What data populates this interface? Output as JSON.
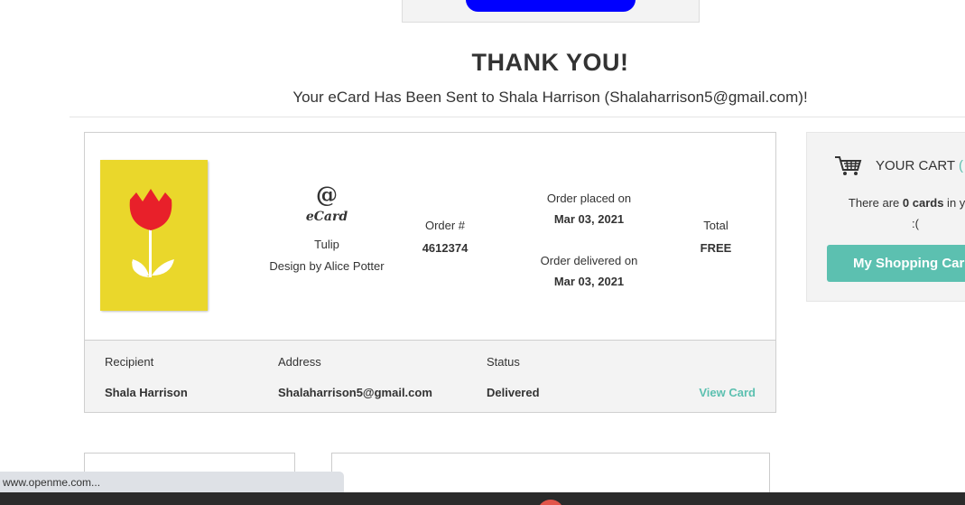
{
  "heading": {
    "title": "THANK YOU!",
    "subtitle": "Your eCard Has Been Sent to Shala Harrison (Shalaharrison5@gmail.com)!"
  },
  "order": {
    "card_icon": "at-sign-icon",
    "card_type": "eCard",
    "card_name": "Tulip",
    "card_designer": "Design by Alice Potter",
    "order_number_label": "Order #",
    "order_number": "4612374",
    "placed_label": "Order placed on",
    "placed_date": "Mar 03, 2021",
    "delivered_label": "Order delivered on",
    "delivered_date": "Mar 03, 2021",
    "total_label": "Total",
    "total_value": "FREE"
  },
  "details": {
    "recipient_label": "Recipient",
    "recipient": "Shala Harrison",
    "address_label": "Address",
    "address": "Shalaharrison5@gmail.com",
    "status_label": "Status",
    "status": "Delivered",
    "view_link": "View Card"
  },
  "cart": {
    "icon": "shopping-cart-icon",
    "title": "YOUR CART",
    "count_visible": "(",
    "message_pre": "There are ",
    "message_count": "0 cards",
    "message_post": " in your",
    "message_face": ":(",
    "button_label": "My Shopping Car"
  },
  "browser": {
    "status_url": "www.openme.com..."
  },
  "colors": {
    "accent": "#5cc0b0",
    "top_button": "#0000ff",
    "card_yellow": "#ead72b",
    "tulip_red": "#e8202a"
  }
}
